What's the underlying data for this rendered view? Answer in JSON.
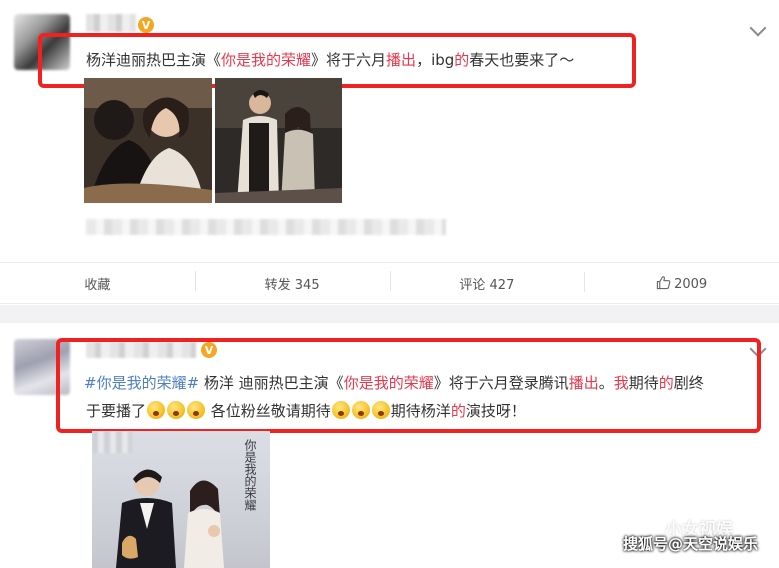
{
  "post1": {
    "verified_badge": "V",
    "text_parts": [
      {
        "t": "杨洋迪丽热巴主演《",
        "c": "normal"
      },
      {
        "t": "你是我的荣耀",
        "c": "hl"
      },
      {
        "t": "》将于六月",
        "c": "normal"
      },
      {
        "t": "播出",
        "c": "hl"
      },
      {
        "t": "，ibg",
        "c": "normal"
      },
      {
        "t": "的",
        "c": "hl"
      },
      {
        "t": "春天也要来了～",
        "c": "normal"
      }
    ],
    "actions": {
      "favorite": "收藏",
      "repost": "转发 345",
      "comment": "评论 427",
      "like_count": "2009"
    }
  },
  "post2": {
    "verified_badge": "V",
    "line1_parts": [
      {
        "t": "#你是我的荣耀#",
        "c": "link"
      },
      {
        "t": " 杨洋 迪丽热巴主演《",
        "c": "normal"
      },
      {
        "t": "你是我的荣耀",
        "c": "hl"
      },
      {
        "t": "》将于六月登录腾讯",
        "c": "normal"
      },
      {
        "t": "播出",
        "c": "hl"
      },
      {
        "t": "。",
        "c": "normal"
      },
      {
        "t": "我",
        "c": "hl"
      },
      {
        "t": "期待",
        "c": "normal"
      },
      {
        "t": "的",
        "c": "hl"
      },
      {
        "t": "剧终",
        "c": "normal"
      }
    ],
    "line2_a": "于要播了",
    "line2_b": " 各位粉丝敬请期待",
    "line2_c": "期待杨洋",
    "line2_d": "的",
    "line2_e": "演技呀！",
    "poster_title": "你是我的荣耀"
  },
  "watermark": {
    "line1": "小女视娱",
    "line2": "搜狐号@天空说娱乐"
  },
  "colors": {
    "highlight": "#e8384c",
    "link": "#4d7ec6",
    "annotation_box": "#f22121",
    "verified": "#f5a623"
  }
}
